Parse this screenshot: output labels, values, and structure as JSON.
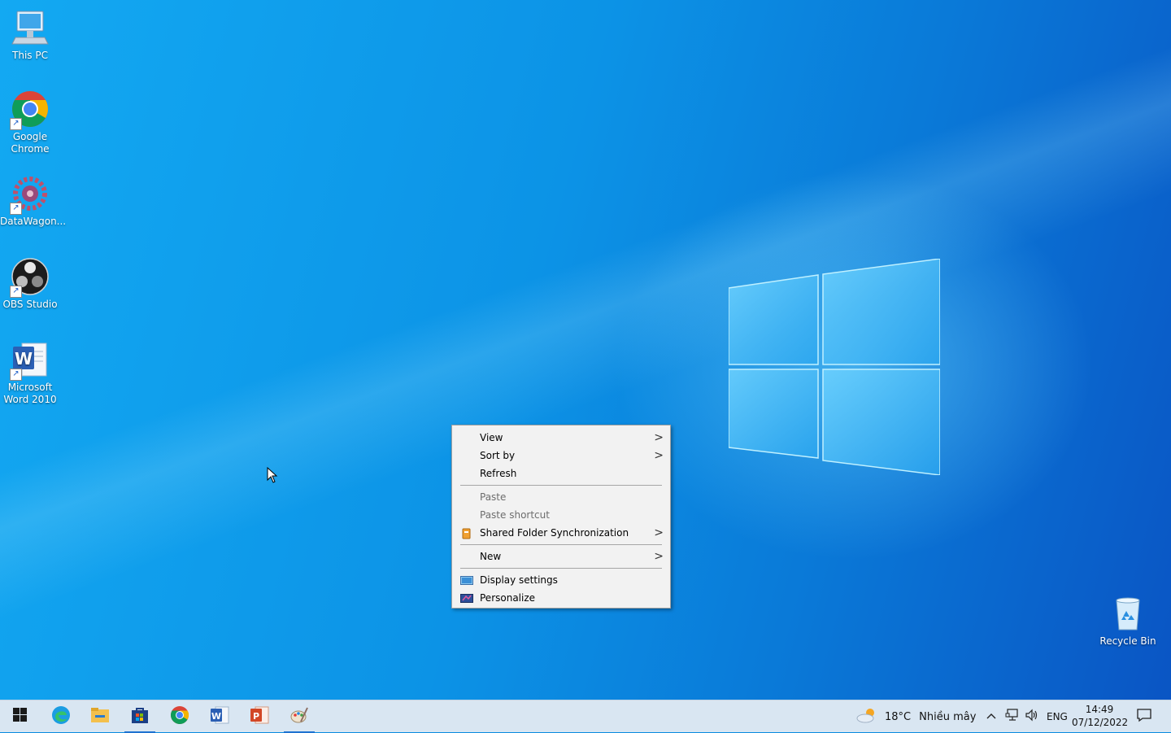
{
  "desktop_icons": {
    "this_pc": "This PC",
    "chrome": "Google Chrome",
    "datawagon": "DataWagon...",
    "obs": "OBS Studio",
    "word": "Microsoft Word 2010",
    "recycle_bin": "Recycle Bin"
  },
  "context_menu": {
    "view": "View",
    "sort_by": "Sort by",
    "refresh": "Refresh",
    "paste": "Paste",
    "paste_shortcut": "Paste shortcut",
    "shared_folder_sync": "Shared Folder Synchronization",
    "new": "New",
    "display_settings": "Display settings",
    "personalize": "Personalize",
    "arrow": ">"
  },
  "taskbar": {
    "apps": [
      "start-icon",
      "edge-icon",
      "file-explorer-icon",
      "store-icon",
      "chrome-icon",
      "word-icon",
      "powerpoint-icon",
      "paint-icon"
    ],
    "weather_temp": "18°C",
    "weather_desc": "Nhiều mây",
    "language": "ENG",
    "time": "14:49",
    "date": "07/12/2022"
  },
  "colors": {
    "accent": "#1f73d1",
    "menu_bg": "#f2f2f2",
    "taskbar_bg": "#d9e6f2"
  }
}
